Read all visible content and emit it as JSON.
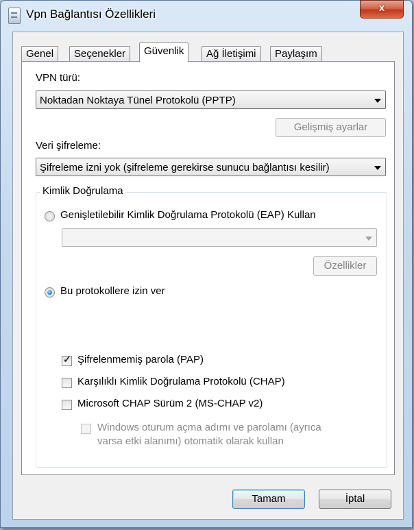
{
  "window": {
    "title": "Vpn Bağlantısı Özellikleri",
    "close_glyph": "x"
  },
  "tabs": [
    {
      "label": "Genel",
      "active": false
    },
    {
      "label": "Seçenekler",
      "active": false
    },
    {
      "label": "Güvenlik",
      "active": true
    },
    {
      "label": "Ağ İletişimi",
      "active": false
    },
    {
      "label": "Paylaşım",
      "active": false
    }
  ],
  "security": {
    "vpn_type_label": "VPN türü:",
    "vpn_type_value": "Noktadan Noktaya Tünel Protokolü (PPTP)",
    "advanced_button": "Gelişmiş ayarlar",
    "encryption_label": "Veri şifreleme:",
    "encryption_value": "Şifreleme izni yok (şifreleme gerekirse sunucu bağlantısı kesilir)",
    "auth_group_title": "Kimlik Doğrulama",
    "eap_radio_label": "Genişletilebilir Kimlik Doğrulama Protokolü (EAP) Kullan",
    "eap_combo_value": "",
    "properties_button": "Özellikler",
    "allow_protocols_label": "Bu protokollere izin ver",
    "pap_label": "Şifrelenmemiş parola (PAP)",
    "chap_label": "Karşılıklı Kimlik Doğrulama Protokolü (CHAP)",
    "mschap_label": "Microsoft CHAP Sürüm 2 (MS-CHAP v2)",
    "windows_logon_line1": "Windows oturum açma adımı ve parolamı (ayrıca",
    "windows_logon_line2": "varsa etki alanımı) otomatik olarak kullan"
  },
  "state": {
    "eap_selected": false,
    "allow_protocols_selected": true,
    "pap_checked": true,
    "chap_checked": false,
    "mschap_checked": false,
    "windows_logon_checked": false
  },
  "footer": {
    "ok_button": "Tamam",
    "cancel_button": "İptal"
  },
  "colors": {
    "window_frame": "#c7daee",
    "close_button": "#c3391c",
    "panel_background": "#ffffff",
    "dialog_background": "#f0f0f0"
  }
}
